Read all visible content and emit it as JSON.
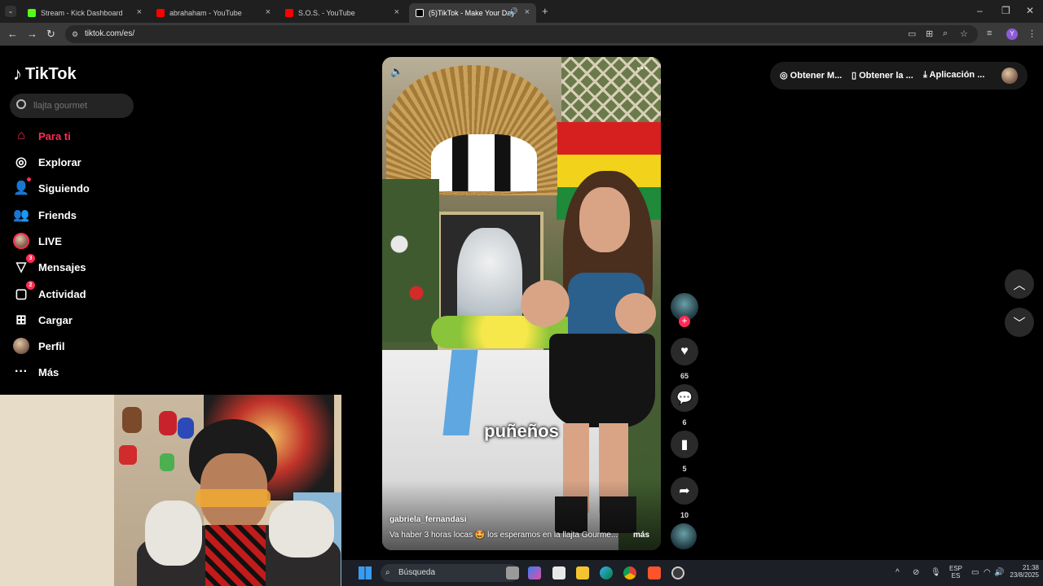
{
  "browser": {
    "tabs": [
      {
        "title": "Stream - Kick Dashboard",
        "color": "#53fc18"
      },
      {
        "title": "abrahaham - YouTube",
        "color": "#ff0000"
      },
      {
        "title": "S.O.S. - YouTube",
        "color": "#ff0000"
      },
      {
        "title": "(5)TikTok - Make Your Day",
        "color": "#ffffff"
      }
    ],
    "url": "tiktok.com/es/"
  },
  "tiktok": {
    "logo": "TikTok",
    "search_placeholder": "llajta gourmet",
    "nav": [
      {
        "label": "Para ti",
        "icon": "home-icon",
        "active": true
      },
      {
        "label": "Explorar",
        "icon": "compass-icon"
      },
      {
        "label": "Siguiendo",
        "icon": "user-follow-icon"
      },
      {
        "label": "Friends",
        "icon": "friends-icon"
      },
      {
        "label": "LIVE",
        "icon": "live-avatar"
      },
      {
        "label": "Mensajes",
        "icon": "send-icon",
        "badge": "3"
      },
      {
        "label": "Actividad",
        "icon": "activity-icon",
        "badge": "2"
      },
      {
        "label": "Cargar",
        "icon": "upload-icon"
      },
      {
        "label": "Perfil",
        "icon": "profile-avatar"
      },
      {
        "label": "Más",
        "icon": "more-icon"
      }
    ],
    "top_right": {
      "pill1": "Obtener M...",
      "pill2": "Obtener la ...",
      "pill3": "Aplicación ..."
    },
    "video": {
      "caption_word": "puñeños",
      "username": "gabriela_fernandasi",
      "description": "Va haber 3 horas locas 🤩 los esperamos en la llajta Gourme...",
      "more": "más"
    },
    "actions": {
      "likes": "65",
      "comments": "6",
      "saves": "5",
      "shares": "10"
    }
  },
  "taskbar": {
    "search": "Búsqueda",
    "lang": "ESP",
    "lang_sub": "ES",
    "time": "21:38",
    "date": "23/8/2025"
  }
}
